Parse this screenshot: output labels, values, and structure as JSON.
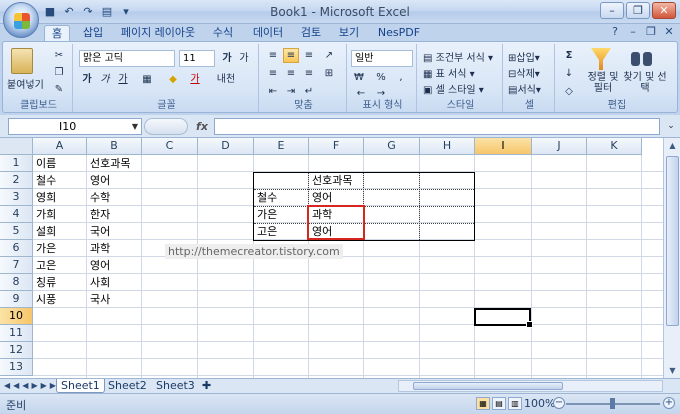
{
  "window": {
    "title": "Book1 - Microsoft Excel",
    "controls": [
      "–",
      "❐",
      "✕"
    ]
  },
  "ribbon_tabs": [
    "홈",
    "삽입",
    "페이지 레이아웃",
    "수식",
    "데이터",
    "검토",
    "보기",
    "NesPDF"
  ],
  "active_tab": "홈",
  "ribbon": {
    "clipboard": {
      "paste": "붙여넣기",
      "label": "클립보드"
    },
    "font": {
      "name": "맑은 고딕",
      "size": "11",
      "label": "글꼴",
      "bold": "가",
      "italic": "가",
      "underline": "가",
      "grow": "가",
      "shrink": "가",
      "phonetic": "내천"
    },
    "alignment": {
      "label": "맞춤"
    },
    "number": {
      "format": "일반",
      "label": "표시 형식"
    },
    "styles": {
      "conditional": "조건부 서식",
      "table": "표 서식",
      "cell": "셀 스타일",
      "label": "스타일"
    },
    "cells": {
      "insert": "삽입",
      "delete": "삭제",
      "format": "서식",
      "label": "셀"
    },
    "editing": {
      "sort": "정렬 및 필터",
      "find": "찾기 및 선택",
      "label": "편집"
    }
  },
  "formula_bar": {
    "name_box": "I10",
    "fx": "fx",
    "formula": ""
  },
  "columns": [
    "A",
    "B",
    "C",
    "D",
    "E",
    "F",
    "G",
    "H",
    "I",
    "J",
    "K"
  ],
  "selected_column": "I",
  "rows": [
    "1",
    "2",
    "3",
    "4",
    "5",
    "6",
    "7",
    "8",
    "9",
    "10",
    "11",
    "12",
    "13"
  ],
  "selected_row": "10",
  "cells": {
    "A1": "이름",
    "B1": "선호과목",
    "A2": "철수",
    "B2": "영어",
    "A3": "영희",
    "B3": "수학",
    "A4": "가희",
    "B4": "한자",
    "A5": "설희",
    "B5": "국어",
    "A6": "가은",
    "B6": "과학",
    "A7": "고은",
    "B7": "영어",
    "A8": "칭류",
    "B8": "사회",
    "A9": "시풍",
    "B9": "국사",
    "F2": "선호과목",
    "E3": "철수",
    "F3": "영어",
    "E4": "가은",
    "F4": "과학",
    "E5": "고은",
    "F5": "영어"
  },
  "watermark": "http://themecreator.tistory.com",
  "sheet_tabs": [
    "Sheet1",
    "Sheet2",
    "Sheet3"
  ],
  "active_sheet": "Sheet1",
  "status": {
    "ready": "준비",
    "zoom": "100%"
  },
  "colors": {
    "accent": "#15428b",
    "highlight_border": "#d6261f",
    "selection_header": "#f6c66a"
  }
}
